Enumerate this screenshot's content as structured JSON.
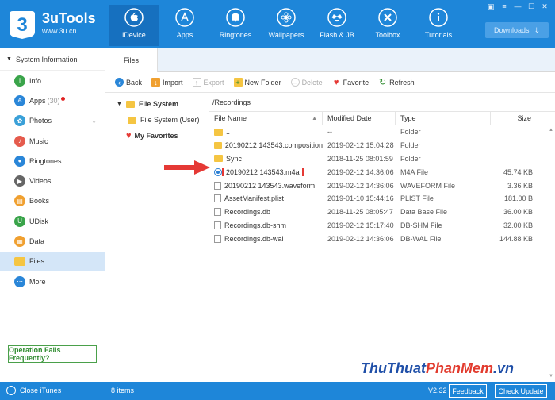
{
  "app": {
    "title": "3uTools",
    "url": "www.3u.cn",
    "logo_text": "3",
    "brand_color": "#1e86d9"
  },
  "nav": [
    {
      "label": "iDevice",
      "icon": "apple-icon",
      "active": true
    },
    {
      "label": "Apps",
      "icon": "app-store-icon"
    },
    {
      "label": "Ringtones",
      "icon": "bell-icon"
    },
    {
      "label": "Wallpapers",
      "icon": "flower-icon"
    },
    {
      "label": "Flash & JB",
      "icon": "dropbox-icon"
    },
    {
      "label": "Toolbox",
      "icon": "tools-icon"
    },
    {
      "label": "Tutorials",
      "icon": "info-icon"
    }
  ],
  "downloads_label": "Downloads",
  "sidebar": {
    "header": "System Information",
    "items": [
      {
        "label": "Info",
        "icon": "info-icon",
        "color": "#3aa44a"
      },
      {
        "label": "Apps",
        "icon": "apps-icon",
        "color": "#2a86d8",
        "count": "(30)"
      },
      {
        "label": "Photos",
        "icon": "photos-icon",
        "color": "#3aa0d8"
      },
      {
        "label": "Music",
        "icon": "music-icon",
        "color": "#e55b4d"
      },
      {
        "label": "Ringtones",
        "icon": "bell-icon",
        "color": "#2a86d8"
      },
      {
        "label": "Videos",
        "icon": "video-icon",
        "color": "#666666"
      },
      {
        "label": "Books",
        "icon": "books-icon",
        "color": "#f0a030"
      },
      {
        "label": "UDisk",
        "icon": "udisk-icon",
        "color": "#3aa44a"
      },
      {
        "label": "Data",
        "icon": "data-icon",
        "color": "#f0a030"
      },
      {
        "label": "Files",
        "icon": "folder-icon",
        "color": "#f5c542",
        "active": true
      },
      {
        "label": "More",
        "icon": "more-icon",
        "color": "#2a86d8"
      }
    ],
    "operation_fails": "Operation Fails Frequently?"
  },
  "tab": "Files",
  "toolbar": {
    "back": "Back",
    "import": "Import",
    "export": "Export",
    "new_folder": "New Folder",
    "delete": "Delete",
    "favorite": "Favorite",
    "refresh": "Refresh"
  },
  "tree": {
    "root": "File System",
    "child": "File System (User)",
    "favorites": "My Favorites"
  },
  "path": "/Recordings",
  "columns": [
    "File Name",
    "Modified Date",
    "Type",
    "Size"
  ],
  "files": [
    {
      "name": "..",
      "date": "--",
      "type": "Folder",
      "size": "",
      "kind": "folder"
    },
    {
      "name": "20190212 143543.composition",
      "date": "2019-02-12 15:04:28",
      "type": "Folder",
      "size": "",
      "kind": "folder"
    },
    {
      "name": "Sync",
      "date": "2018-11-25 08:01:59",
      "type": "Folder",
      "size": "",
      "kind": "folder"
    },
    {
      "name": "20190212 143543.m4a",
      "date": "2019-02-12 14:36:06",
      "type": "M4A File",
      "size": "45.74 KB",
      "kind": "audio",
      "highlighted": true
    },
    {
      "name": "20190212 143543.waveform",
      "date": "2019-02-12 14:36:06",
      "type": "WAVEFORM File",
      "size": "3.36 KB",
      "kind": "file"
    },
    {
      "name": "AssetManifest.plist",
      "date": "2019-01-10 15:44:16",
      "type": "PLIST File",
      "size": "181.00 B",
      "kind": "file"
    },
    {
      "name": "Recordings.db",
      "date": "2018-11-25 08:05:47",
      "type": "Data Base File",
      "size": "36.00 KB",
      "kind": "file"
    },
    {
      "name": "Recordings.db-shm",
      "date": "2019-02-12 15:17:40",
      "type": "DB-SHM File",
      "size": "32.00 KB",
      "kind": "file"
    },
    {
      "name": "Recordings.db-wal",
      "date": "2019-02-12 14:36:06",
      "type": "DB-WAL File",
      "size": "144.88 KB",
      "kind": "file"
    }
  ],
  "status": {
    "close_itunes": "Close iTunes",
    "items": "8 items",
    "version": "V2.32",
    "feedback": "Feedback",
    "check_update": "Check Update"
  },
  "watermark": {
    "part1": "ThuThuat",
    "part2": "PhanMem",
    "part3": ".vn"
  }
}
